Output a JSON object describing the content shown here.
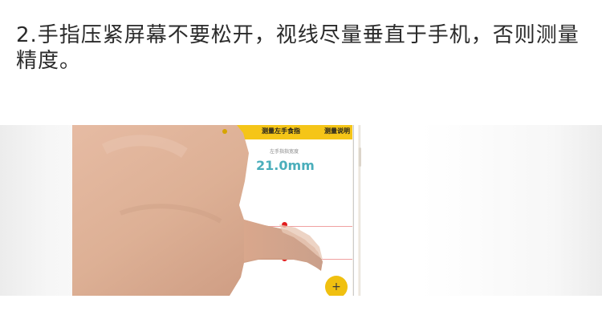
{
  "instruction": {
    "text": "2.手指压紧屏幕不要松开，视线尽量垂直于手机，否则测量精度。"
  },
  "app": {
    "title": "测量左手食指",
    "help_label": "测量说明",
    "measure_label": "左手指指宽度",
    "measure_value": "21.0mm",
    "fab_icon": "plus-icon",
    "accent_color": "#f5c518",
    "value_color": "#4aaebb",
    "handle_color": "#e21d1d"
  }
}
